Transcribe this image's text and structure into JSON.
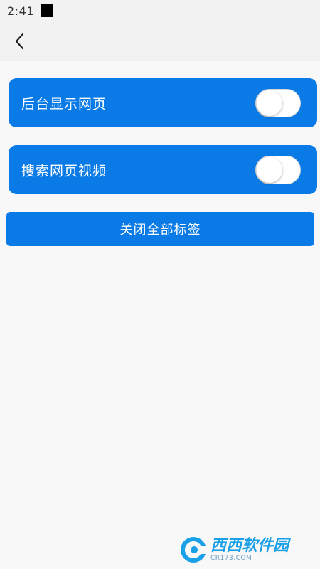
{
  "status_bar": {
    "time": "2:41"
  },
  "toolbar": {
    "back_icon": "chevron-left-icon"
  },
  "settings": [
    {
      "label": "后台显示网页",
      "enabled": false
    },
    {
      "label": "搜索网页视频",
      "enabled": false
    }
  ],
  "actions": {
    "close_all_label": "关闭全部标签"
  },
  "watermark": {
    "text": "西西软件园",
    "domain": "CR173.COM"
  },
  "colors": {
    "accent": "#0a7ae6",
    "background": "#f8f8f8",
    "bar": "#f2f2f2"
  }
}
